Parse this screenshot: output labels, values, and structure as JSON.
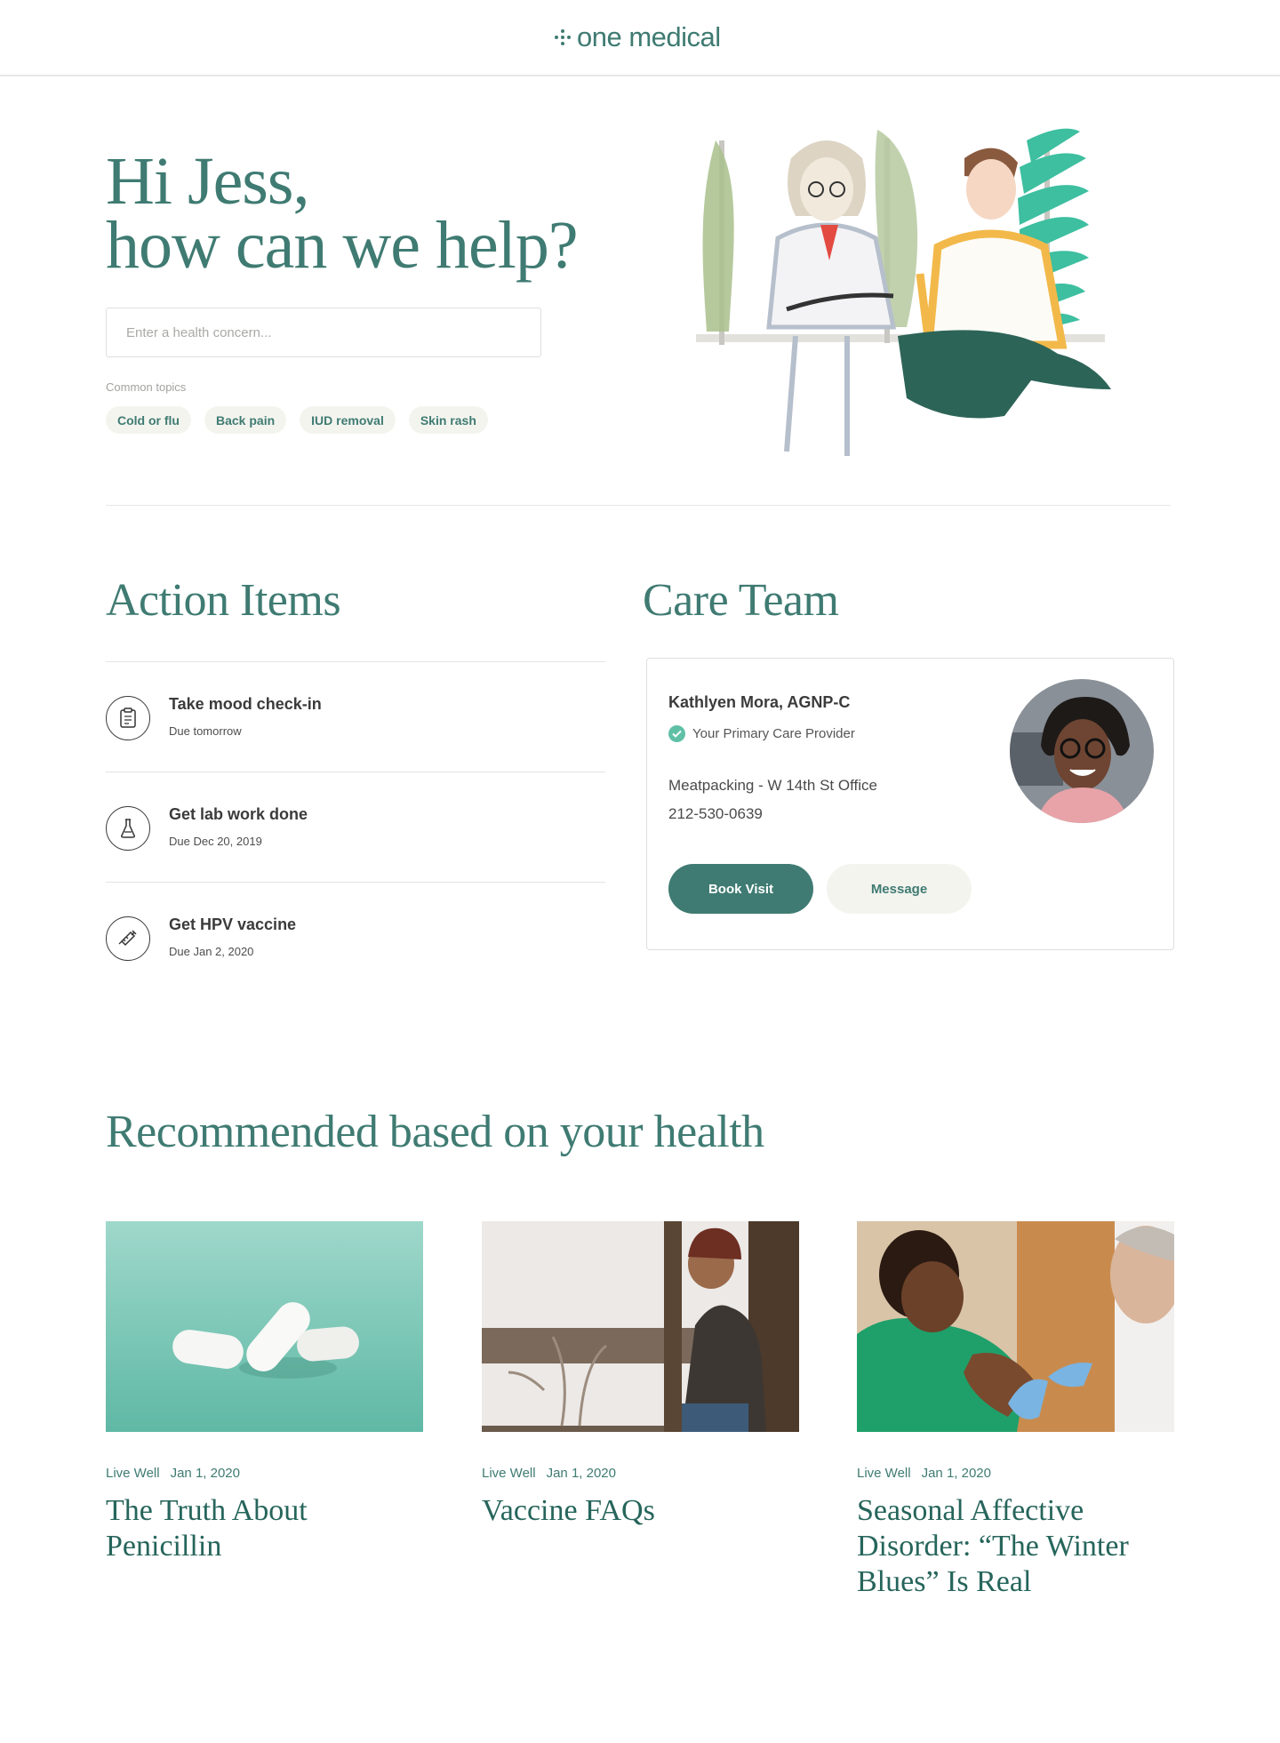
{
  "header": {
    "logo_text": "one medical"
  },
  "hero": {
    "greeting_line1": "Hi Jess,",
    "greeting_line2": "how can we help?",
    "search_placeholder": "Enter a health concern...",
    "topics_label": "Common topics",
    "topics": [
      "Cold or flu",
      "Back pain",
      "IUD removal",
      "Skin rash"
    ]
  },
  "action_items": {
    "title": "Action Items",
    "items": [
      {
        "title": "Take mood check-in",
        "due": "Due tomorrow",
        "icon": "clipboard-icon"
      },
      {
        "title": "Get lab work done",
        "due": "Due Dec 20, 2019",
        "icon": "flask-icon"
      },
      {
        "title": "Get HPV vaccine",
        "due": "Due Jan 2, 2020",
        "icon": "syringe-icon"
      }
    ]
  },
  "care_team": {
    "title": "Care Team",
    "provider_name": "Kathlyen Mora, AGNP-C",
    "provider_role": "Your Primary Care Provider",
    "office": "Meatpacking - W 14th St Office",
    "phone": "212-530-0639",
    "book_label": "Book Visit",
    "message_label": "Message"
  },
  "recommended": {
    "title": "Recommended based on your health",
    "articles": [
      {
        "category": "Live Well",
        "date": "Jan 1, 2020",
        "title": "The Truth About Penicillin"
      },
      {
        "category": "Live Well",
        "date": "Jan 1, 2020",
        "title": "Vaccine FAQs"
      },
      {
        "category": "Live Well",
        "date": "Jan 1, 2020",
        "title": "Seasonal Affective Disorder: “The Winter Blues” Is Real"
      }
    ]
  },
  "colors": {
    "brand": "#3f7b72",
    "chip_bg": "#f4f4ef",
    "check": "#5fc0a6"
  }
}
